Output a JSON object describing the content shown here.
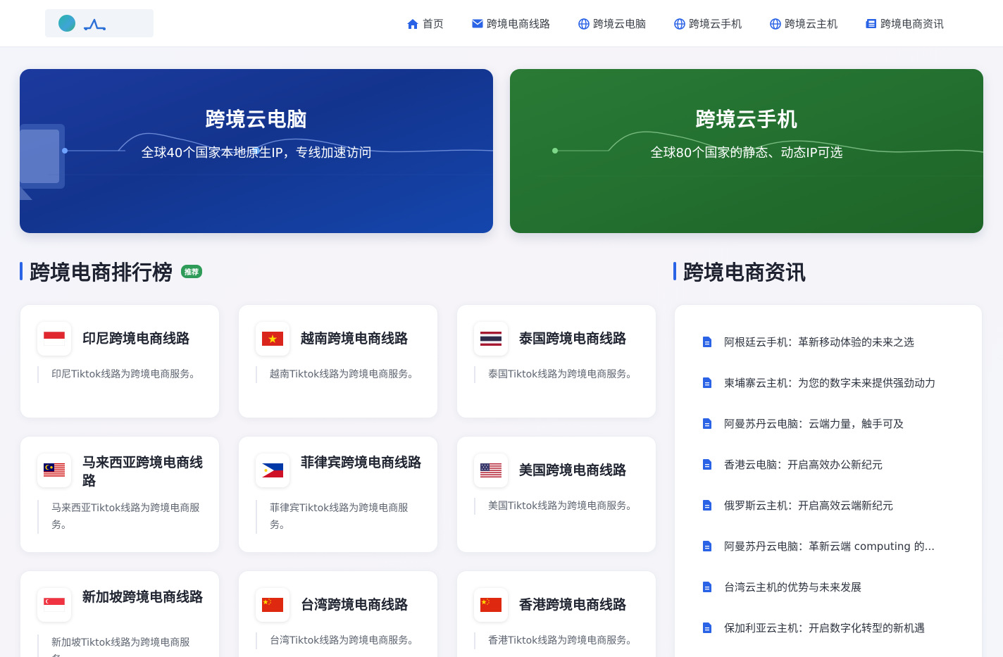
{
  "nav": {
    "items": [
      {
        "label": "首页",
        "icon": "home-icon"
      },
      {
        "label": "跨境电商线路",
        "icon": "mail-icon"
      },
      {
        "label": "跨境云电脑",
        "icon": "globe-icon"
      },
      {
        "label": "跨境云手机",
        "icon": "globe-icon"
      },
      {
        "label": "跨境云主机",
        "icon": "globe-icon"
      },
      {
        "label": "跨境电商资讯",
        "icon": "newspaper-icon"
      }
    ]
  },
  "banners": {
    "cloud_pc": {
      "title": "跨境云电脑",
      "subtitle": "全球40个国家本地原生IP，专线加速访问",
      "color": "#173a9c"
    },
    "cloud_phone": {
      "title": "跨境云手机",
      "subtitle": "全球80个国家的静态、动态IP可选",
      "color": "#25722f"
    }
  },
  "ranking": {
    "title": "跨境电商排行榜",
    "tag": "推荐",
    "cards": [
      {
        "flag": "indonesia",
        "title": "印尼跨境电商线路",
        "desc": "印尼Tiktok线路为跨境电商服务。"
      },
      {
        "flag": "vietnam",
        "title": "越南跨境电商线路",
        "desc": "越南Tiktok线路为跨境电商服务。"
      },
      {
        "flag": "thailand",
        "title": "泰国跨境电商线路",
        "desc": "泰国Tiktok线路为跨境电商服务。"
      },
      {
        "flag": "malaysia",
        "title": "马来西亚跨境电商线路",
        "desc": "马来西亚Tiktok线路为跨境电商服务。"
      },
      {
        "flag": "philippines",
        "title": "菲律宾跨境电商线路",
        "desc": "菲律宾Tiktok线路为跨境电商服务。"
      },
      {
        "flag": "usa",
        "title": "美国跨境电商线路",
        "desc": "美国Tiktok线路为跨境电商服务。"
      },
      {
        "flag": "singapore",
        "title": "新加坡跨境电商线路",
        "desc": "新加坡Tiktok线路为跨境电商服务。"
      },
      {
        "flag": "china",
        "title": "台湾跨境电商线路",
        "desc": "台湾Tiktok线路为跨境电商服务。"
      },
      {
        "flag": "china",
        "title": "香港跨境电商线路",
        "desc": "香港Tiktok线路为跨境电商服务。"
      }
    ]
  },
  "news": {
    "title": "跨境电商资讯",
    "items": [
      "阿根廷云手机：革新移动体验的未来之选",
      "柬埔寨云主机：为您的数字未来提供强劲动力",
      "阿曼苏丹云电脑：云端力量，触手可及",
      "香港云电脑：开启高效办公新纪元",
      "俄罗斯云主机：开启高效云端新纪元",
      "阿曼苏丹云电脑：革新云端 computing 的...",
      "台湾云主机的优势与未来发展",
      "保加利亚云主机：开启数字化转型的新机遇"
    ]
  }
}
